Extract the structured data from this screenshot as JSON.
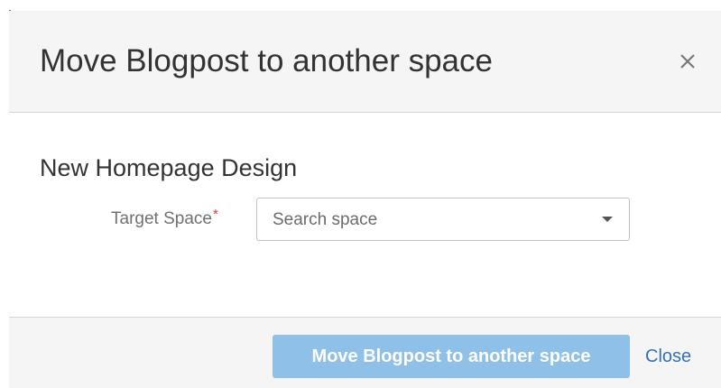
{
  "dialog": {
    "title": "Move Blogpost to another space",
    "close_icon": "close-icon"
  },
  "content": {
    "page_name": "New Homepage Design",
    "target_space_label": "Target Space",
    "required_marker": "*",
    "target_space_placeholder": "Search space",
    "dropdown_icon": "chevron-down-icon"
  },
  "footer": {
    "submit_label": "Move Blogpost to another space",
    "close_label": "Close"
  },
  "colors": {
    "primary_button": "#8fc0e8",
    "link": "#3572b0",
    "required": "#d04437"
  }
}
